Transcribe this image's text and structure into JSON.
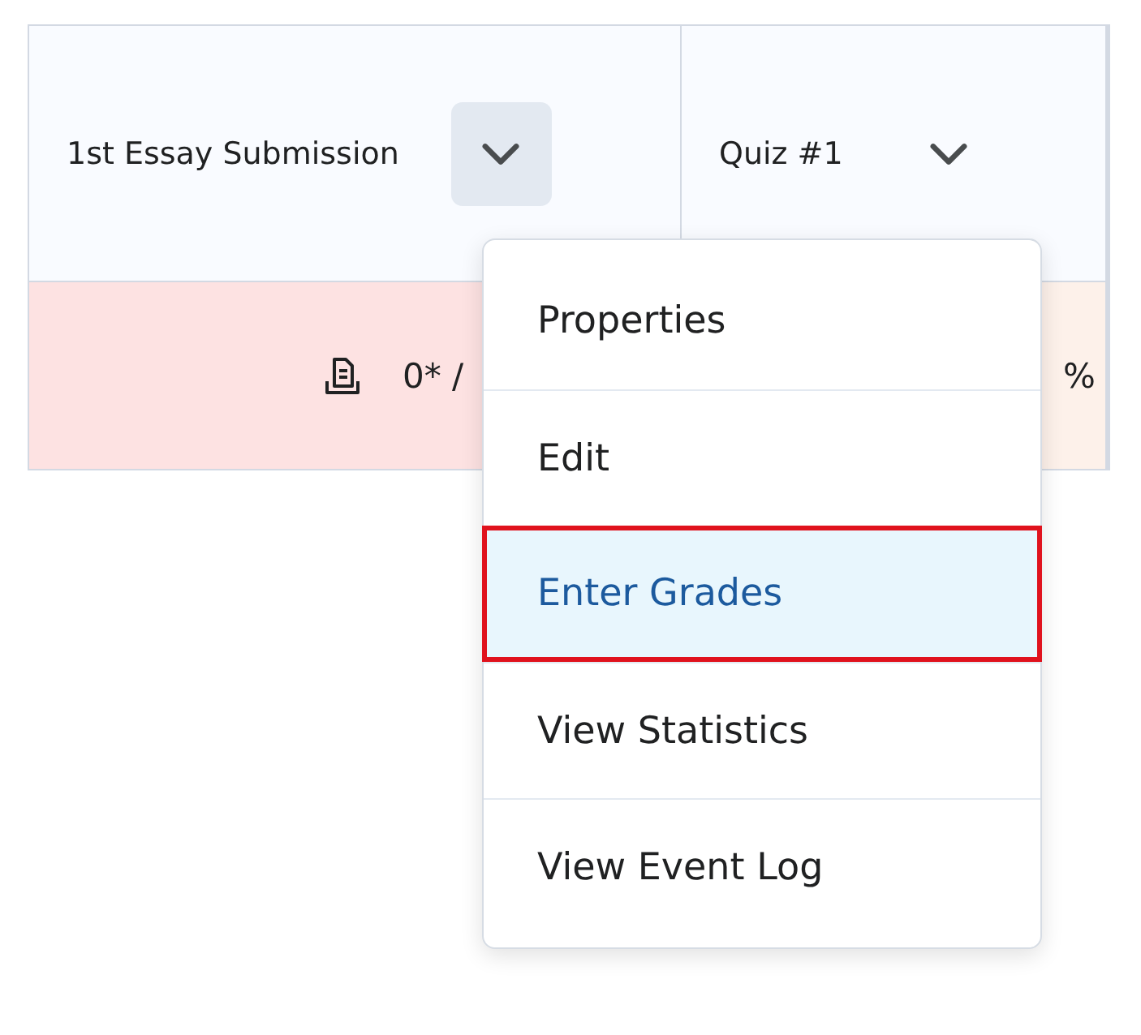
{
  "table": {
    "columns": [
      {
        "title": "1st Essay Submission",
        "menu_open": true
      },
      {
        "title": "Quiz #1",
        "menu_open": false
      }
    ],
    "rows": [
      {
        "cells": [
          {
            "kind": "grade",
            "value": "0* /",
            "color": "#fde2e2"
          },
          {
            "kind": "percent",
            "value": "%",
            "color": "#fdf1ea"
          }
        ]
      }
    ]
  },
  "menu": {
    "items": [
      {
        "label": "Properties",
        "selected": false
      },
      {
        "label": "Edit",
        "selected": false
      },
      {
        "label": "Enter Grades",
        "selected": true
      },
      {
        "label": "View Statistics",
        "selected": false
      },
      {
        "label": "View Event Log",
        "selected": false
      }
    ]
  }
}
